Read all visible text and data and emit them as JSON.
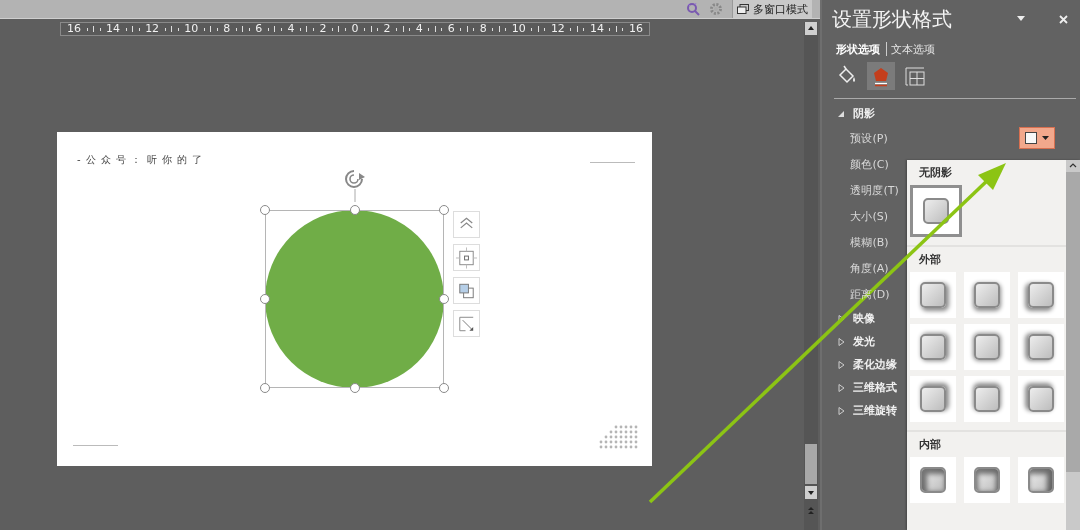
{
  "toolbar": {
    "multi_window_button": "多窗口模式"
  },
  "ruler": {
    "labels": [
      "16",
      "14",
      "12",
      "10",
      "8",
      "6",
      "4",
      "2",
      "0",
      "2",
      "4",
      "6",
      "8",
      "10",
      "12",
      "14",
      "16"
    ]
  },
  "slide": {
    "header_text": "- 公 众 号 ： 听 你 的 了",
    "shape": {
      "kind": "circle",
      "color": "#70ad47",
      "selected": true
    }
  },
  "panel": {
    "title": "设置形状格式",
    "tabs": [
      {
        "label": "形状选项",
        "selected": true
      },
      {
        "label": "文本选项",
        "selected": false
      }
    ],
    "category_icons": [
      {
        "kind": "fill",
        "selected": false
      },
      {
        "kind": "effects",
        "selected": true
      },
      {
        "kind": "size",
        "selected": false
      }
    ],
    "sections": [
      {
        "title": "阴影",
        "expanded": true,
        "properties": [
          {
            "label": "预设(P)",
            "kind": "preset"
          },
          {
            "label": "颜色(C)",
            "kind": "plain"
          },
          {
            "label": "透明度(T)",
            "kind": "plain"
          },
          {
            "label": "大小(S)",
            "kind": "plain"
          },
          {
            "label": "模糊(B)",
            "kind": "plain"
          },
          {
            "label": "角度(A)",
            "kind": "plain"
          },
          {
            "label": "距离(D)",
            "kind": "plain"
          }
        ]
      },
      {
        "title": "映像",
        "expanded": false
      },
      {
        "title": "发光",
        "expanded": false
      },
      {
        "title": "柔化边缘",
        "expanded": false
      },
      {
        "title": "三维格式",
        "expanded": false
      },
      {
        "title": "三维旋转",
        "expanded": false
      }
    ]
  },
  "preset_menu": {
    "groups": [
      {
        "title": "无阴影",
        "kind": "none",
        "tiles": [
          {
            "selected": true
          }
        ]
      },
      {
        "title": "外部",
        "kind": "outer",
        "tiles": [
          {
            "selected": false
          },
          {
            "selected": false
          },
          {
            "selected": false
          },
          {
            "selected": false
          },
          {
            "selected": false
          },
          {
            "selected": false
          },
          {
            "selected": false
          },
          {
            "selected": false
          },
          {
            "selected": false
          }
        ]
      },
      {
        "title": "内部",
        "kind": "inner",
        "tiles": [
          {
            "selected": false
          },
          {
            "selected": false
          },
          {
            "selected": false
          }
        ]
      }
    ]
  },
  "annotation": {
    "kind": "arrow"
  }
}
